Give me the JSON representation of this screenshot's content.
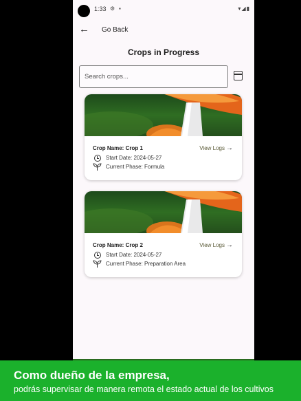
{
  "status_bar": {
    "time": "1:33",
    "icons": [
      "gear-icon",
      "sd-card-icon",
      "wifi-icon",
      "signal-icon",
      "battery-icon"
    ]
  },
  "nav": {
    "back_icon": "arrow-left-icon",
    "back_label": "Go Back"
  },
  "page": {
    "title": "Crops in Progress"
  },
  "search": {
    "placeholder": "Search crops...",
    "value": "",
    "calendar_icon": "calendar-icon"
  },
  "crops": [
    {
      "name": "Crop Name: Crop 1",
      "view_logs": "View Logs",
      "start_date": "Start Date: 2024-05-27",
      "phase": "Current Phase: Formula"
    },
    {
      "name": "Crop Name: Crop 2",
      "view_logs": "View Logs",
      "start_date": "Start Date: 2024-05-27",
      "phase": "Current Phase: Preparation Area"
    }
  ],
  "banner": {
    "line1": "Como dueño de la empresa,",
    "line2": "podrás supervisar de manera remota el estado actual de los cultivos"
  },
  "colors": {
    "accent_green": "#1bb12c",
    "app_background": "#fcf8fb",
    "link_color": "#5a5a37"
  }
}
